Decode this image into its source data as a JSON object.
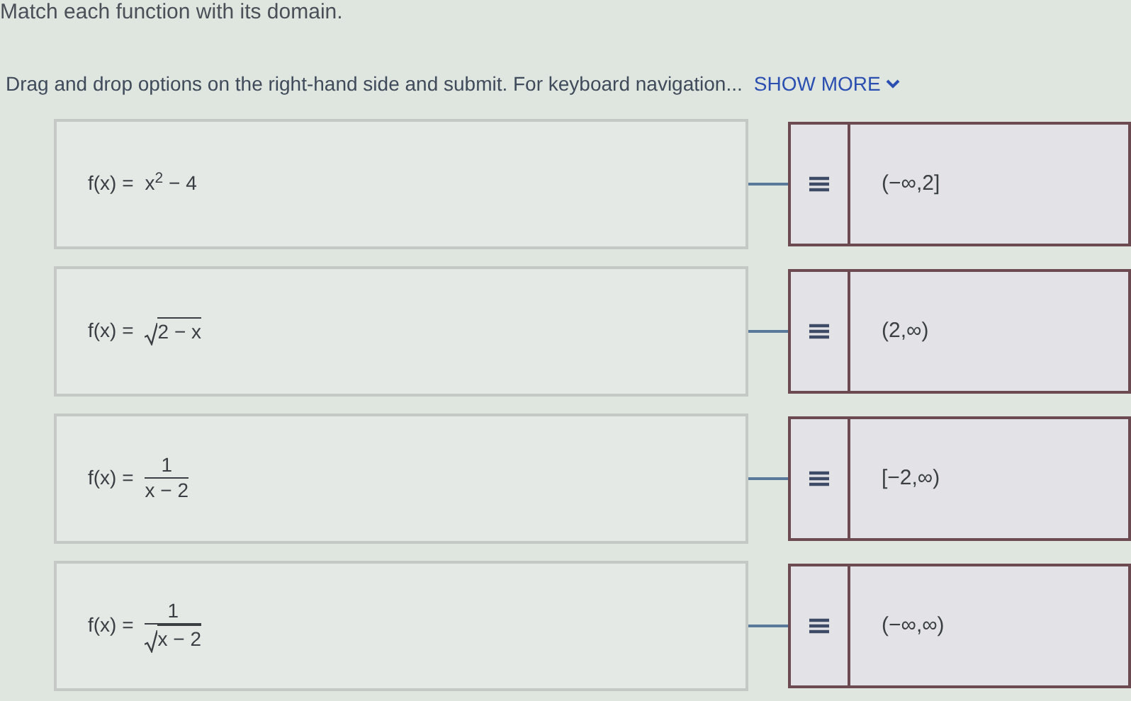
{
  "title": "Match each function with its domain.",
  "instructions": {
    "text": "Drag and drop options on the right-hand side and submit. For keyboard navigation...",
    "link": "SHOW MORE"
  },
  "pairs": [
    {
      "function": {
        "kind": "power",
        "lhs": "f(x) =",
        "rhs": "x$^{2}$ − 4"
      },
      "answer": "(−∞,2]"
    },
    {
      "function": {
        "kind": "sqrt",
        "lhs": "f(x) =",
        "radicand": "2 − x"
      },
      "answer": "(2,∞)"
    },
    {
      "function": {
        "kind": "fraction",
        "lhs": "f(x) =",
        "numerator": "1",
        "denominator": "x − 2",
        "root": false
      },
      "answer": "[−2,∞)"
    },
    {
      "function": {
        "kind": "fraction",
        "lhs": "f(x) =",
        "numerator": "1",
        "denominator": "x − 2",
        "root": true
      },
      "answer": "(−∞,∞)"
    }
  ]
}
